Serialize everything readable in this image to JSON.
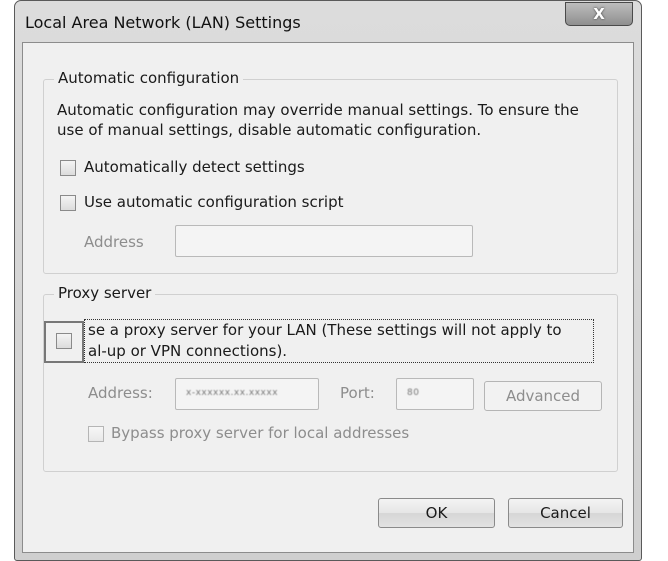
{
  "window": {
    "title": "Local Area Network (LAN) Settings",
    "close_glyph": "X"
  },
  "auto_config": {
    "legend": "Automatic configuration",
    "description_line1": "Automatic configuration may override manual settings.  To ensure the",
    "description_line2": "use of manual settings, disable automatic configuration.",
    "auto_detect_label": "Automatically detect settings",
    "auto_detect_checked": false,
    "use_script_label": "Use automatic configuration script",
    "use_script_checked": false,
    "address_label": "Address",
    "address_value": ""
  },
  "proxy": {
    "legend": "Proxy server",
    "use_proxy_line1": "se a proxy server for your LAN (These settings will not apply to",
    "use_proxy_line2": "al-up or VPN connections).",
    "use_proxy_checked": false,
    "address_label": "Address:",
    "address_value": "x-xxxxxx.xx.xxxxx",
    "port_label": "Port:",
    "port_value": "80",
    "advanced_label": "Advanced",
    "bypass_label": "Bypass proxy server for local addresses",
    "bypass_checked": false
  },
  "buttons": {
    "ok": "OK",
    "cancel": "Cancel"
  }
}
